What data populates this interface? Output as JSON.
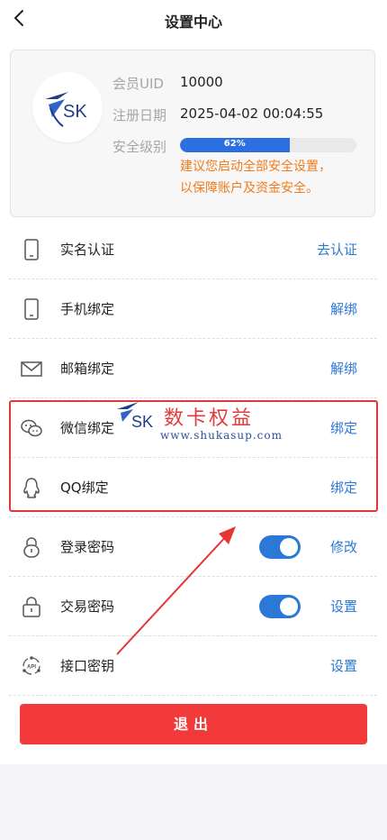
{
  "header": {
    "title": "设置中心"
  },
  "profile": {
    "uid_label": "会员UID",
    "uid_value": "10000",
    "reg_label": "注册日期",
    "reg_value": "2025-04-02 00:04:55",
    "security_label": "安全级别",
    "security_percent": 62,
    "security_percent_text": "62%",
    "tip_line1": "建议您启动全部安全设置，",
    "tip_line2": "以保障账户及资金安全。",
    "logo_text": "SK"
  },
  "items": [
    {
      "label": "实名认证",
      "action": "去认证",
      "icon": "phone-icon"
    },
    {
      "label": "手机绑定",
      "action": "解绑",
      "icon": "phone-icon"
    },
    {
      "label": "邮箱绑定",
      "action": "解绑",
      "icon": "mail-icon"
    },
    {
      "label": "微信绑定",
      "action": "绑定",
      "icon": "wechat-icon"
    },
    {
      "label": "QQ绑定",
      "action": "绑定",
      "icon": "qq-icon"
    },
    {
      "label": "登录密码",
      "action": "修改",
      "icon": "lock-icon",
      "toggle": true
    },
    {
      "label": "交易密码",
      "action": "设置",
      "icon": "lock-icon",
      "toggle": true
    },
    {
      "label": "接口密钥",
      "action": "设置",
      "icon": "api-icon"
    }
  ],
  "logout_label": "退出",
  "watermark": {
    "logo_text": "SK",
    "title": "数卡权益",
    "url": "www.shukasup.com"
  },
  "colors": {
    "accent": "#2c78d6",
    "danger": "#f23a3a",
    "tip": "#f07c1c"
  }
}
